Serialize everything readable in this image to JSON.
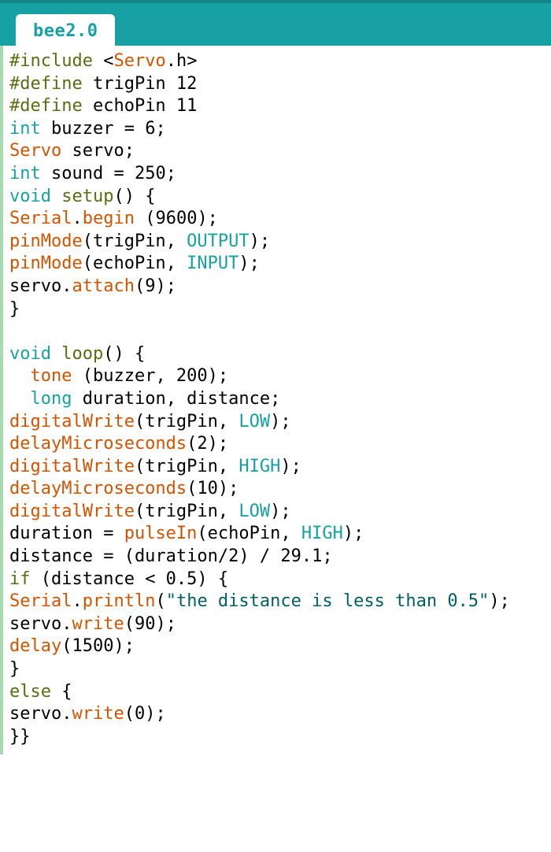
{
  "tab": {
    "label": "bee2.0"
  },
  "code": {
    "l1": {
      "a": "#include",
      "b": " <",
      "c": "Servo",
      "d": ".h>"
    },
    "l2": {
      "a": "#define",
      "b": " trigPin 12"
    },
    "l3": {
      "a": "#define",
      "b": " echoPin 11"
    },
    "l4": {
      "a": "int",
      "b": " buzzer = 6;"
    },
    "l5": {
      "a": "Servo",
      "b": " servo;"
    },
    "l6": {
      "a": "int",
      "b": " sound = 250;"
    },
    "l7": {
      "a": "void",
      "b": " ",
      "c": "setup",
      "d": "() {"
    },
    "l8": {
      "a": "Serial",
      "b": ".",
      "c": "begin",
      "d": " (9600);"
    },
    "l9": {
      "a": "pinMode",
      "b": "(trigPin, ",
      "c": "OUTPUT",
      "d": ");"
    },
    "l10": {
      "a": "pinMode",
      "b": "(echoPin, ",
      "c": "INPUT",
      "d": ");"
    },
    "l11": {
      "a": "servo.",
      "b": "attach",
      "c": "(9);"
    },
    "l12": {
      "a": "}"
    },
    "l13": {
      "a": ""
    },
    "l14": {
      "a": "void",
      "b": " ",
      "c": "loop",
      "d": "() {"
    },
    "l15": {
      "a": "  ",
      "b": "tone",
      "c": " (buzzer, 200);"
    },
    "l16": {
      "a": "  ",
      "b": "long",
      "c": " duration, distance;"
    },
    "l17": {
      "a": "digitalWrite",
      "b": "(trigPin, ",
      "c": "LOW",
      "d": ");"
    },
    "l18": {
      "a": "delayMicroseconds",
      "b": "(2);"
    },
    "l19": {
      "a": "digitalWrite",
      "b": "(trigPin, ",
      "c": "HIGH",
      "d": ");"
    },
    "l20": {
      "a": "delayMicroseconds",
      "b": "(10);"
    },
    "l21": {
      "a": "digitalWrite",
      "b": "(trigPin, ",
      "c": "LOW",
      "d": ");"
    },
    "l22": {
      "a": "duration = ",
      "b": "pulseIn",
      "c": "(echoPin, ",
      "d": "HIGH",
      "e": ");"
    },
    "l23": {
      "a": "distance = (duration/2) / 29.1;"
    },
    "l24": {
      "a": "if",
      "b": " (distance < 0.5) {"
    },
    "l25": {
      "a": "Serial",
      "b": ".",
      "c": "println",
      "d": "(",
      "e": "\"the distance is less than 0.5\"",
      "f": ");"
    },
    "l26": {
      "a": "servo.",
      "b": "write",
      "c": "(90);"
    },
    "l27": {
      "a": "delay",
      "b": "(1500);"
    },
    "l28": {
      "a": "}"
    },
    "l29": {
      "a": "else",
      "b": " {"
    },
    "l30": {
      "a": "servo.",
      "b": "write",
      "c": "(0);"
    },
    "l31": {
      "a": "}}"
    }
  }
}
